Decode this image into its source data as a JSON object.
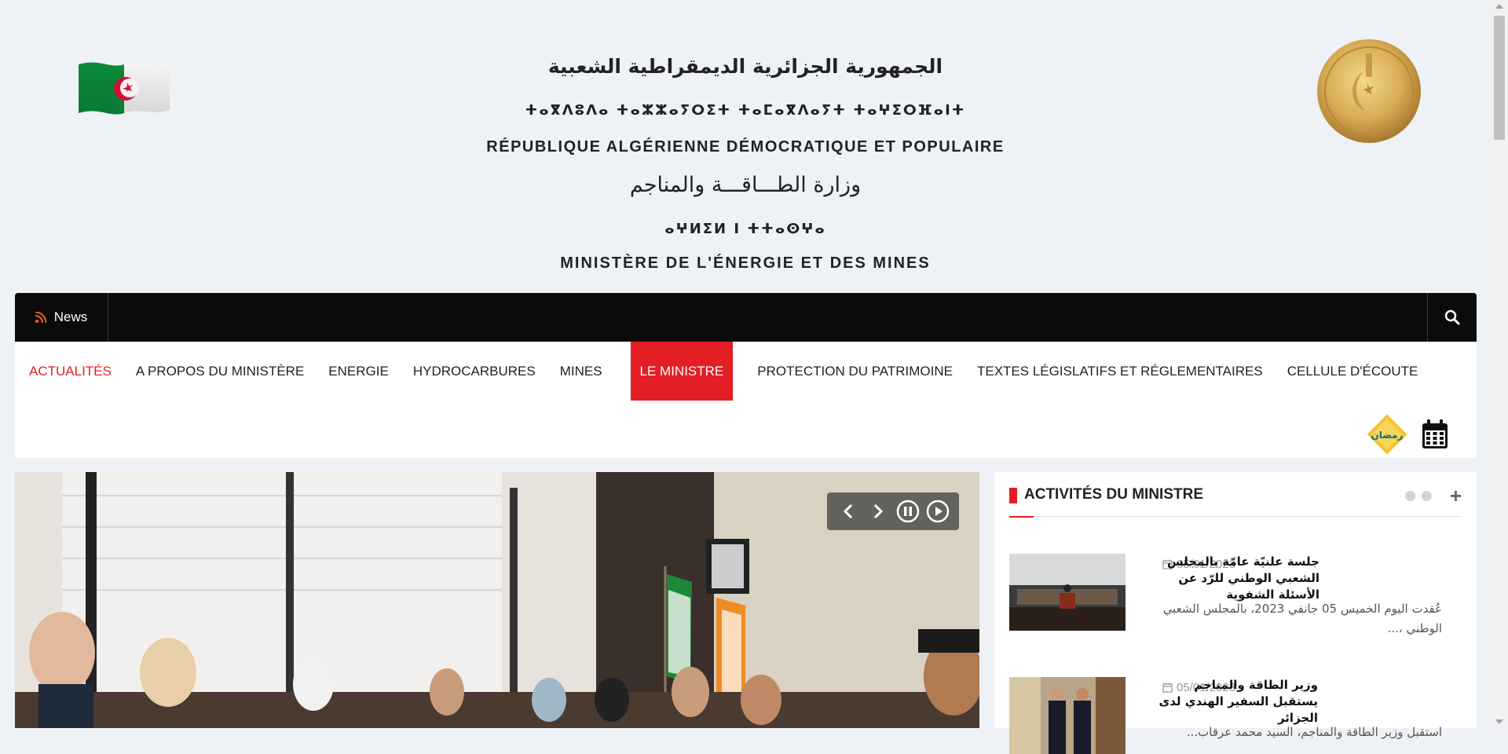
{
  "header": {
    "arabic_republic": "الجمهورية الجزائرية الديمقراطية الشعبية",
    "tifinagh_republic": "ⵜⴰⴳⴷⵓⴷⴰ ⵜⴰⵣⵣⴰⵢⵔⵉⵜ ⵜⴰⵎⴰⴳⴷⴰⵢⵜ ⵜⴰⵖⵉⵔⴼⴰⵏⵜ",
    "french_republic": "RÉPUBLIQUE ALGÉRIENNE DÉMOCRATIQUE ET POPULAIRE",
    "arabic_ministry": "وزارة الطـــاقـــة والمناجم",
    "tifinagh_ministry": "ⴰⵖⵍⵉⵍ ⵏ ⵜⵜⴰⵙⵖⴰ",
    "french_ministry": "MINISTÈRE DE L'ÉNERGIE ET DES MINES"
  },
  "newsbar": {
    "label": "News",
    "search_icon": "search-icon",
    "rss_icon": "rss-icon"
  },
  "nav": {
    "items": [
      "ACTUALITÉS",
      "A PROPOS DU MINISTÈRE",
      "ENERGIE",
      "HYDROCARBURES",
      "MINES",
      "LE MINISTRE",
      "PROTECTION DU PATRIMOINE",
      "TEXTES LÉGISLATIFS ET RÉGLEMENTAIRES",
      "CELLULE D'ÉCOUTE"
    ],
    "active": "LE MINISTRE",
    "ramadan_logo_text": "رمضانيات"
  },
  "slider": {
    "controls": [
      "chevron-left-icon",
      "chevron-right-icon",
      "pause-icon",
      "play-icon"
    ]
  },
  "panel": {
    "title": "ACTIVITÉS DU MINISTRE",
    "items": [
      {
        "date": "05/01/2023",
        "title": "جلسة علنيّة عامّة بالمجلس الشعبي الوطني للرّد عن الأسئلة الشفوية",
        "excerpt": "عُقدت اليوم الخميس 05 جانفي 2023، بالمجلس الشعبي الوطني ،..."
      },
      {
        "date": "05/01/2023",
        "title": "وزير الطاقة والمناجم يستقبل السفير الهندي لدى الجزائر",
        "excerpt": "استقبل وزير الطاقة والمناجم، السيد محمد عرقاب..."
      }
    ]
  },
  "colors": {
    "accent": "#e31e24",
    "newsbar": "#0b0b0b",
    "background": "#eef1f5"
  }
}
